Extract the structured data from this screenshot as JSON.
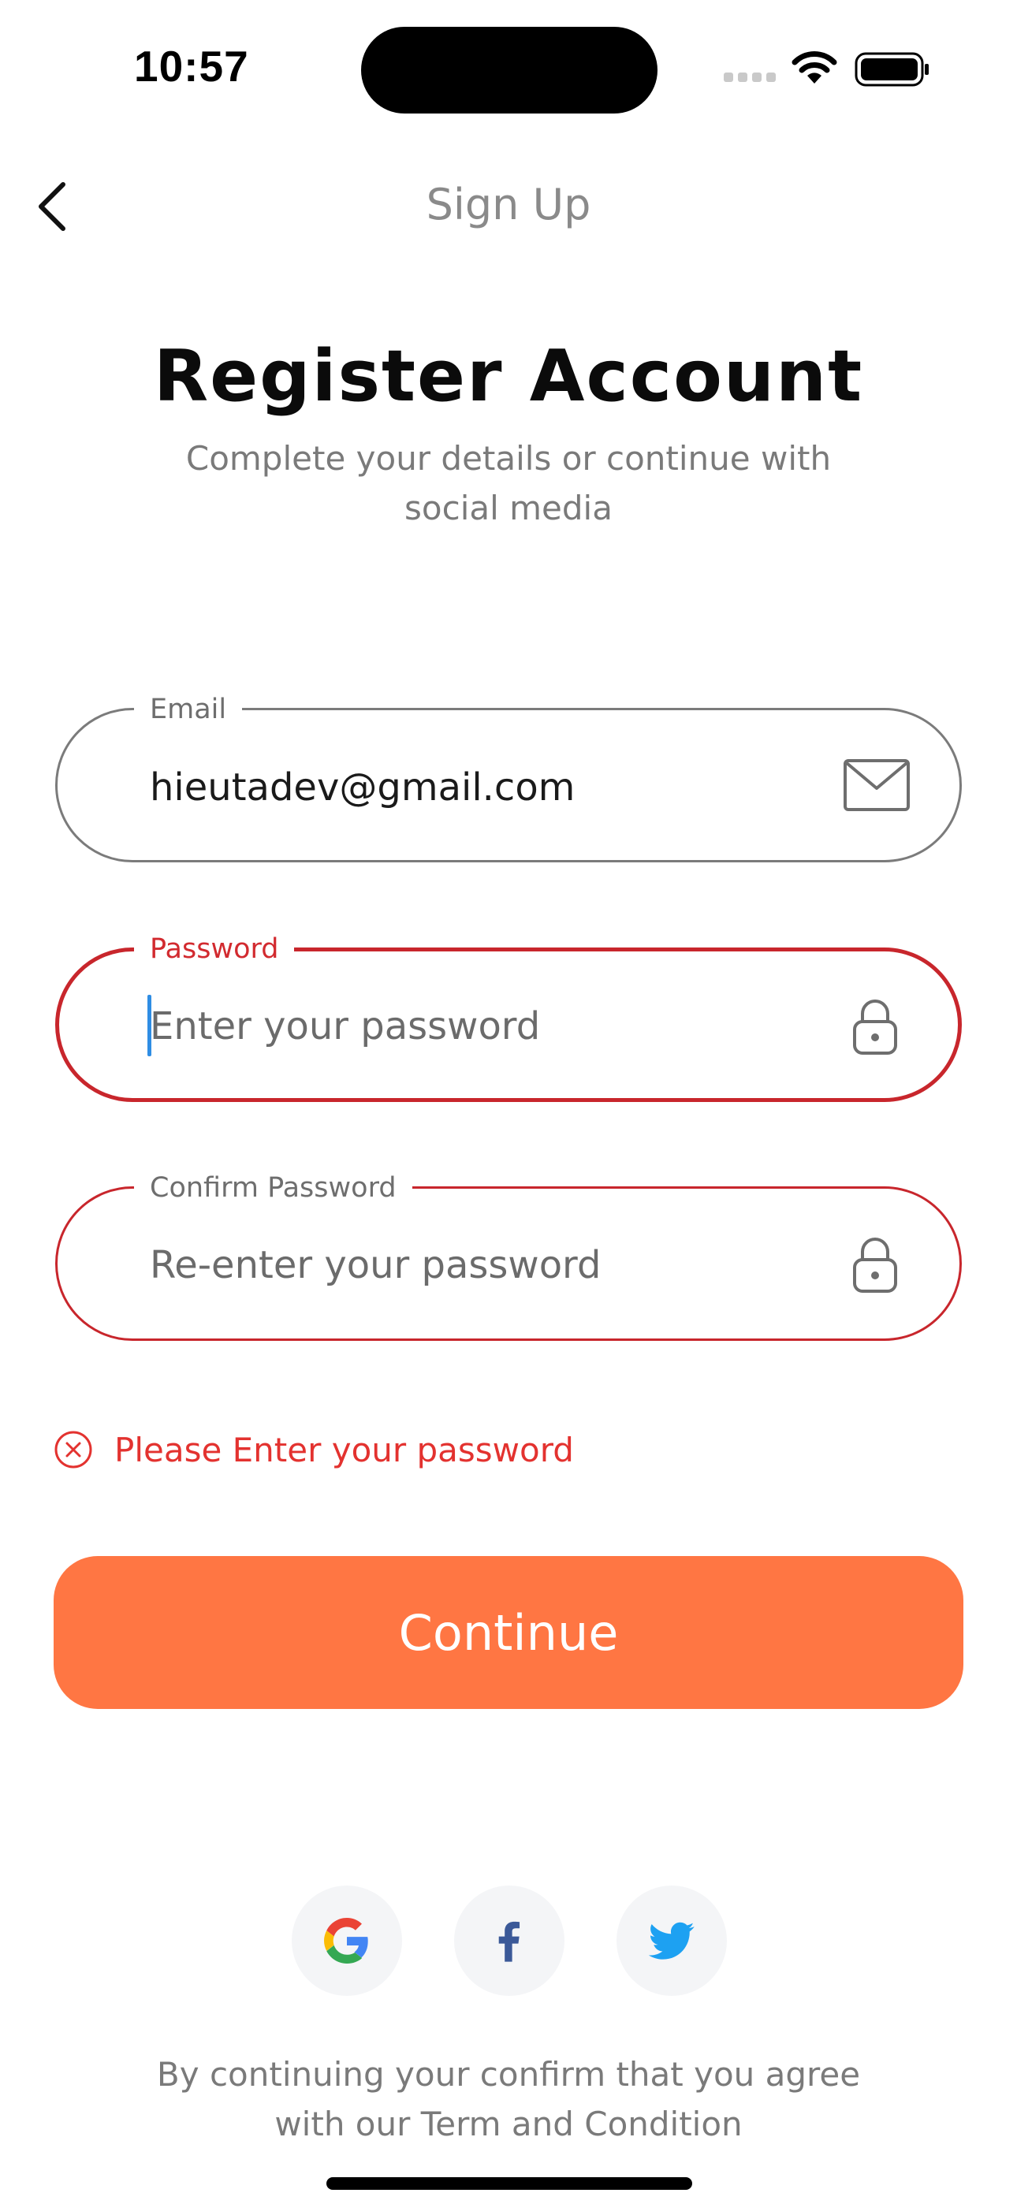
{
  "status_bar": {
    "time": "10:57"
  },
  "nav": {
    "title": "Sign Up",
    "back_icon": "chevron-left-icon"
  },
  "header": {
    "title": "Register Account",
    "subtitle": "Complete your details or continue with social media"
  },
  "form": {
    "email": {
      "label": "Email",
      "value": "hieutadev@gmail.com",
      "icon": "mail-icon"
    },
    "password": {
      "label": "Password",
      "placeholder": "Enter your password",
      "icon": "lock-icon",
      "state": "error-focused"
    },
    "confirm_password": {
      "label": "Confirm Password",
      "placeholder": "Re-enter your password",
      "icon": "lock-icon",
      "state": "error"
    },
    "error_message": "Please Enter your password"
  },
  "actions": {
    "continue_label": "Continue"
  },
  "social": [
    {
      "name": "google",
      "icon": "google-icon"
    },
    {
      "name": "facebook",
      "icon": "facebook-icon"
    },
    {
      "name": "twitter",
      "icon": "twitter-icon"
    }
  ],
  "footer": {
    "terms": "By continuing your confirm that you agree with our Term and Condition"
  },
  "colors": {
    "accent": "#ff7643",
    "error": "#d22a2f",
    "field_border": "#7b7b7b",
    "social_bg": "#f4f5f7"
  }
}
